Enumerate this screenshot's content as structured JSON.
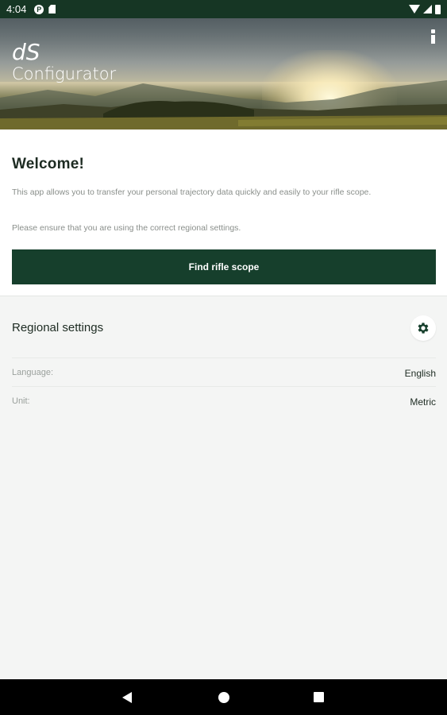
{
  "status_bar": {
    "time": "4:04",
    "icons": [
      "pocket-icon",
      "sd-card-icon",
      "wifi-icon",
      "signal-icon",
      "battery-icon"
    ]
  },
  "header": {
    "logo_line1": "dS",
    "logo_line2": "Configurator",
    "menu_icon": "info-icon"
  },
  "welcome": {
    "title": "Welcome!",
    "text1": "This app allows you to transfer your personal trajectory data quickly and easily to your rifle scope.",
    "text2": "Please ensure that you are using the correct regional settings.",
    "button_label": "Find rifle scope"
  },
  "regional": {
    "title": "Regional settings",
    "settings_icon": "gear-icon",
    "rows": [
      {
        "label": "Language:",
        "value": "English"
      },
      {
        "label": "Unit:",
        "value": "Metric"
      }
    ]
  },
  "nav_bar": {
    "icons": [
      "back-icon",
      "home-icon",
      "recents-icon"
    ]
  },
  "colors": {
    "status_bar": "#163624",
    "primary_button": "#163f2c",
    "background": "#f4f5f4",
    "title_text": "#1d2b22",
    "muted_text": "#8a8f8b"
  }
}
